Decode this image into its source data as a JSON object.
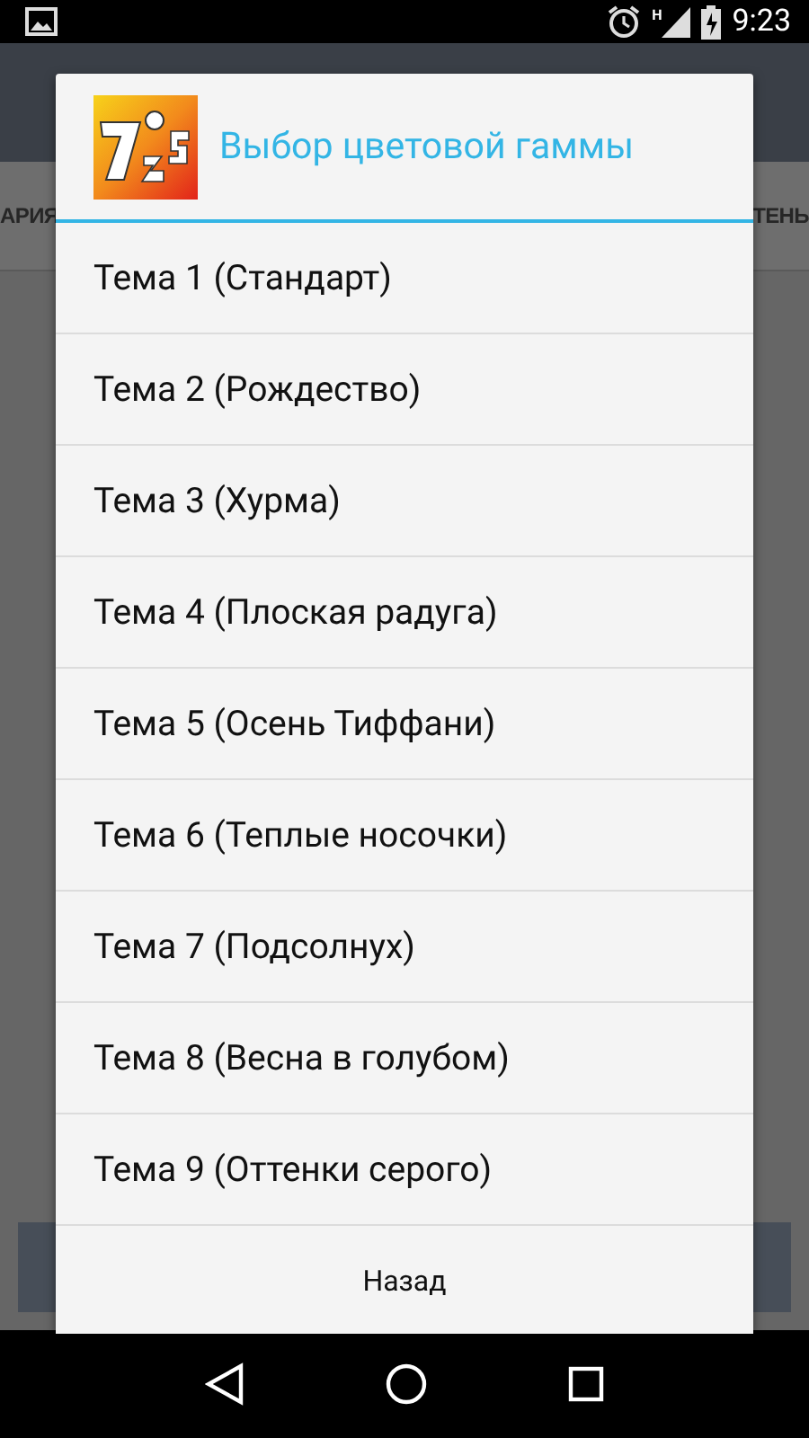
{
  "status_bar": {
    "time": "9:23",
    "network_label": "H"
  },
  "background": {
    "tabs": [
      {
        "label": "АРИЯ"
      },
      {
        "label": "ТЕНЬ"
      }
    ]
  },
  "dialog": {
    "title": "Выбор цветовой гаммы",
    "items": [
      {
        "label": "Тема 1 (Стандарт)"
      },
      {
        "label": "Тема 2 (Рождество)"
      },
      {
        "label": "Тема 3 (Хурма)"
      },
      {
        "label": "Тема 4 (Плоская радуга)"
      },
      {
        "label": "Тема 5 (Осень Тиффани)"
      },
      {
        "label": "Тема 6 (Теплые носочки)"
      },
      {
        "label": "Тема 7 (Подсолнух)"
      },
      {
        "label": "Тема 8 (Весна в голубом)"
      },
      {
        "label": "Тема 9 (Оттенки серого)"
      }
    ],
    "button": "Назад"
  }
}
